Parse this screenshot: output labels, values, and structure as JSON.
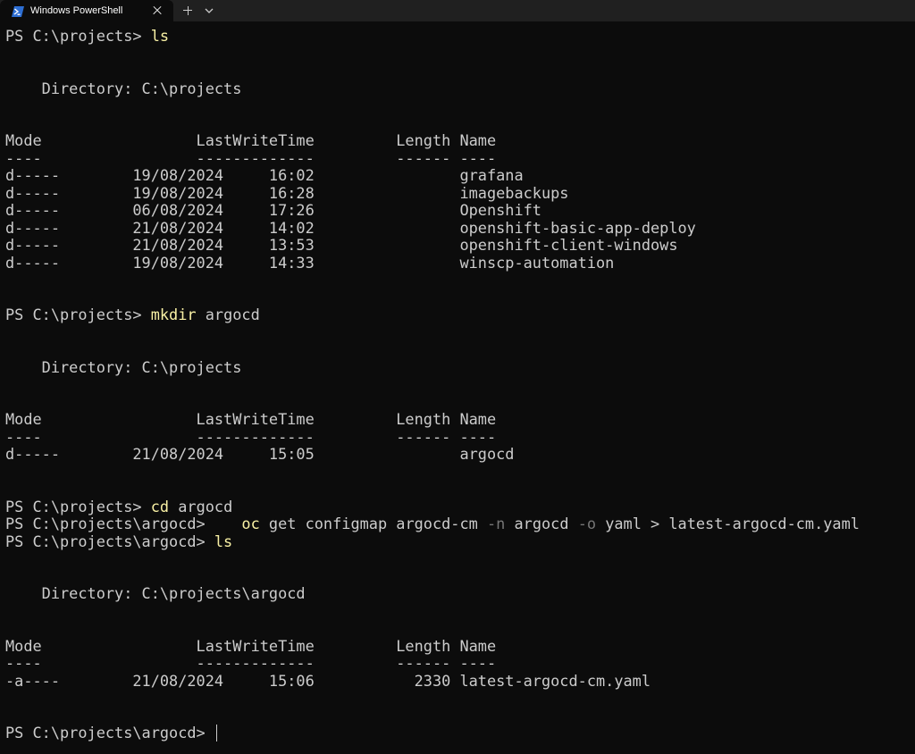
{
  "window": {
    "tab_title": "Windows PowerShell",
    "tab_icon": "powershell-icon",
    "new_tab_icon": "plus-icon",
    "dropdown_icon": "chevron-down-icon"
  },
  "colors": {
    "background": "#0c0c0c",
    "text": "#cccccc",
    "command": "#f9f1a5",
    "parameter": "#767676",
    "tabbar": "#202020"
  },
  "terminal": {
    "lines": [
      {
        "prompt": "PS C:\\projects> ",
        "cmd": "ls"
      },
      "",
      "",
      "    Directory: C:\\projects",
      "",
      "",
      "Mode                 LastWriteTime         Length Name",
      "----                 -------------         ------ ----",
      "d-----        19/08/2024     16:02                grafana",
      "d-----        19/08/2024     16:28                imagebackups",
      "d-----        06/08/2024     17:26                Openshift",
      "d-----        21/08/2024     14:02                openshift-basic-app-deploy",
      "d-----        21/08/2024     13:53                openshift-client-windows",
      "d-----        19/08/2024     14:33                winscp-automation",
      "",
      "",
      {
        "prompt": "PS C:\\projects> ",
        "cmd": "mkdir",
        "rest": " argocd"
      },
      "",
      "",
      "    Directory: C:\\projects",
      "",
      "",
      "Mode                 LastWriteTime         Length Name",
      "----                 -------------         ------ ----",
      "d-----        21/08/2024     15:05                argocd",
      "",
      "",
      {
        "prompt": "PS C:\\projects> ",
        "cmd": "cd",
        "rest": " argocd"
      },
      {
        "prompt": "PS C:\\projects\\argocd>    ",
        "cmd": "oc",
        "parts": [
          {
            "t": " get configmap argocd-cm "
          },
          {
            "t": "-n",
            "c": "param"
          },
          {
            "t": " argocd "
          },
          {
            "t": "-o",
            "c": "param"
          },
          {
            "t": " yaml > latest-argocd-cm.yaml"
          }
        ]
      },
      {
        "prompt": "PS C:\\projects\\argocd> ",
        "cmd": "ls"
      },
      "",
      "",
      "    Directory: C:\\projects\\argocd",
      "",
      "",
      "Mode                 LastWriteTime         Length Name",
      "----                 -------------         ------ ----",
      "-a----        21/08/2024     15:06           2330 latest-argocd-cm.yaml",
      "",
      "",
      {
        "prompt": "PS C:\\projects\\argocd> ",
        "cursor": true
      }
    ]
  }
}
